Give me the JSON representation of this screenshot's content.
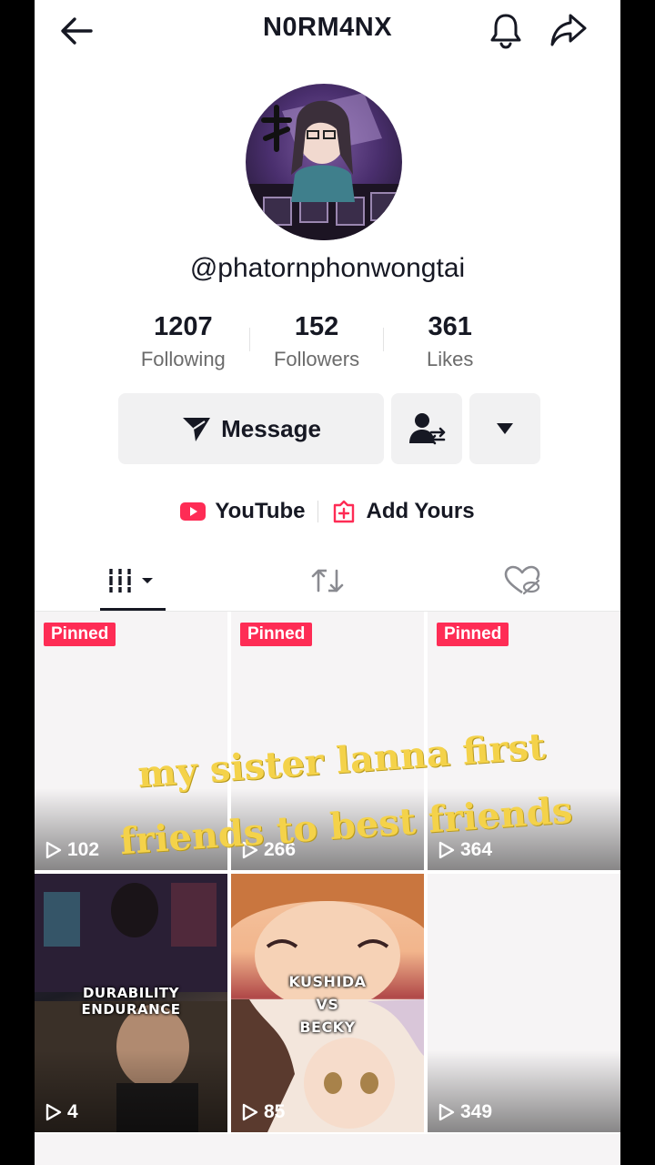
{
  "header": {
    "title": "N0RM4NX"
  },
  "profile": {
    "username": "@phatornphonwongtai"
  },
  "stats": [
    {
      "value": "1207",
      "label": "Following"
    },
    {
      "value": "152",
      "label": "Followers"
    },
    {
      "value": "361",
      "label": "Likes"
    }
  ],
  "actions": {
    "message_label": "Message"
  },
  "links": {
    "youtube": "YouTube",
    "add_yours": "Add Yours"
  },
  "videos": [
    {
      "pinned": "Pinned",
      "views": "102"
    },
    {
      "pinned": "Pinned",
      "views": "266"
    },
    {
      "pinned": "Pinned",
      "views": "364"
    },
    {
      "views": "4",
      "text_lines": [
        "DURABILITY",
        "ENDURANCE"
      ]
    },
    {
      "views": "85",
      "text_lines": [
        "KUSHIDA",
        "VS",
        "BECKY"
      ]
    },
    {
      "views": "349"
    }
  ],
  "overlay_caption": {
    "line1": "my sister lanna first",
    "line2": "friends to best friends"
  },
  "colors": {
    "accent": "#fe2c55",
    "text_primary": "#161823",
    "caption": "#f4d24a"
  }
}
